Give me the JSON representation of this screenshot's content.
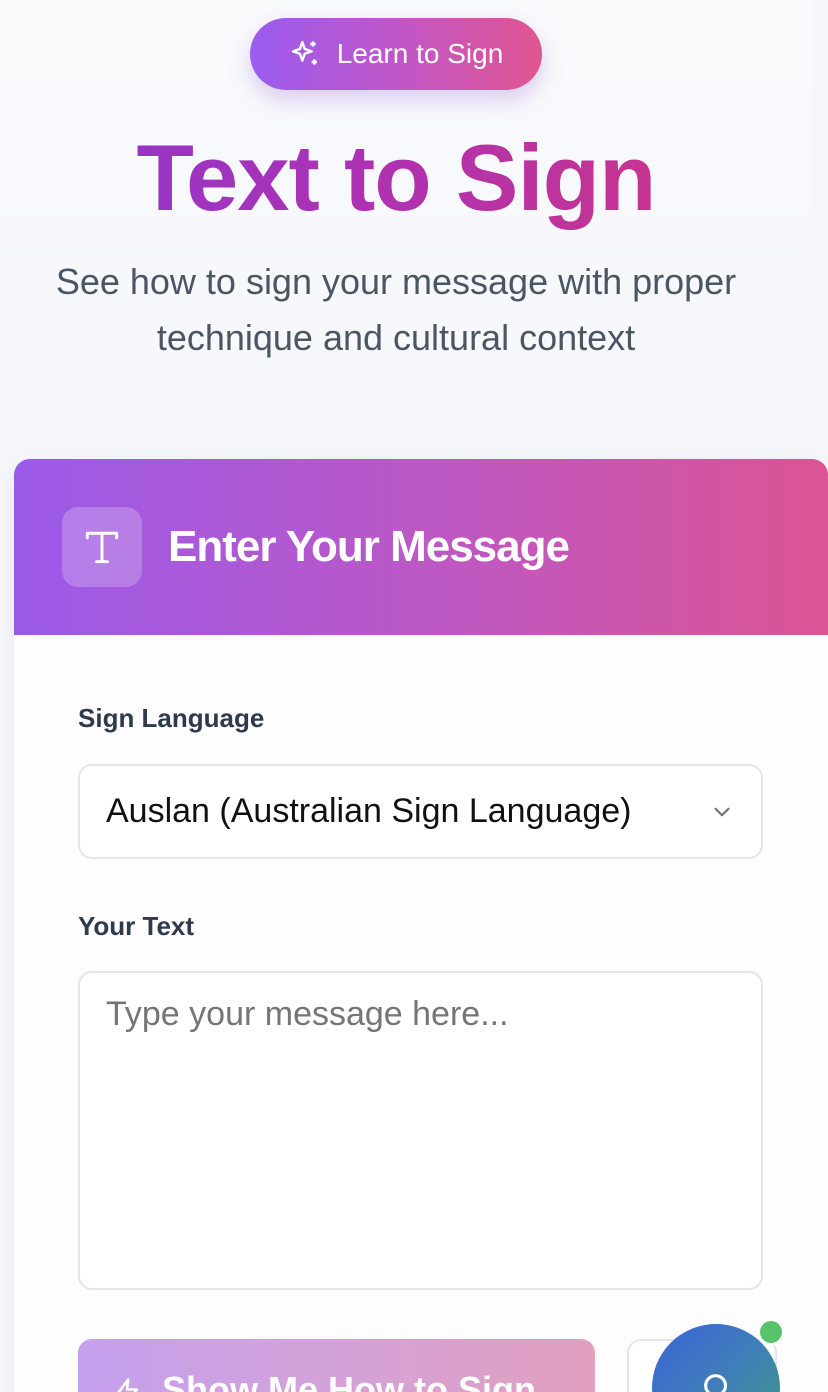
{
  "hero": {
    "badge_label": "Learn to Sign",
    "badge_icon": "sparkles-icon",
    "title": "Text to Sign",
    "subtitle": "See how to sign your message with proper technique and cultural context"
  },
  "card": {
    "header_icon": "text-icon",
    "title": "Enter Your Message",
    "language_label": "Sign Language",
    "language_selected": "Auslan (Australian Sign Language)",
    "text_label": "Your Text",
    "text_placeholder": "Type your message here...",
    "primary_button_label": "Show Me How to Sign",
    "primary_button_icon": "zap-icon"
  },
  "fab": {
    "icon": "search-icon",
    "status_color": "#57c46b"
  },
  "colors": {
    "gradient_start": "#9b5ae9",
    "gradient_end": "#dc5494",
    "title_gradient_start": "#8b36cf",
    "title_gradient_end": "#d2357e"
  }
}
